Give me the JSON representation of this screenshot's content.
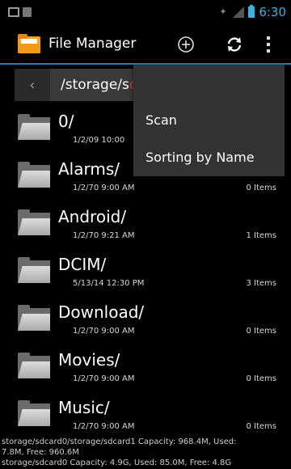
{
  "status_bar": {
    "time": "6:30"
  },
  "action_bar": {
    "title": "File Manager"
  },
  "path": {
    "prefix": "/storage/s",
    "suffix": "d"
  },
  "files": [
    {
      "name": "0/",
      "date": "1/2/09 10:00",
      "items": ""
    },
    {
      "name": "Alarms/",
      "date": "1/2/70 9:00 AM",
      "items": "0 Items"
    },
    {
      "name": "Android/",
      "date": "1/2/70 9:21 AM",
      "items": "1 Items"
    },
    {
      "name": "DCIM/",
      "date": "5/13/14 12:30 PM",
      "items": "3 Items"
    },
    {
      "name": "Download/",
      "date": "1/2/70 9:00 AM",
      "items": "0 Items"
    },
    {
      "name": "Movies/",
      "date": "1/2/70 9:00 AM",
      "items": "0 Items"
    },
    {
      "name": "Music/",
      "date": "1/2/70 9:00 AM",
      "items": "0 Items"
    }
  ],
  "footer": {
    "line1": "storage/sdcard0/storage/sdcard1  Capacity: 968.4M, Used: ",
    "line2": "7.8M, Free: 960.6M",
    "line3": "storage/sdcard0 Capacity: 4.9G, Used: 85.0M, Free: 4.8G"
  },
  "menu": {
    "scan": "Scan",
    "sort": "Sorting by Name"
  },
  "colors": {
    "accent": "#33b5e5",
    "divider": "#2a7fa3",
    "path_highlight": "#e23b2e"
  }
}
